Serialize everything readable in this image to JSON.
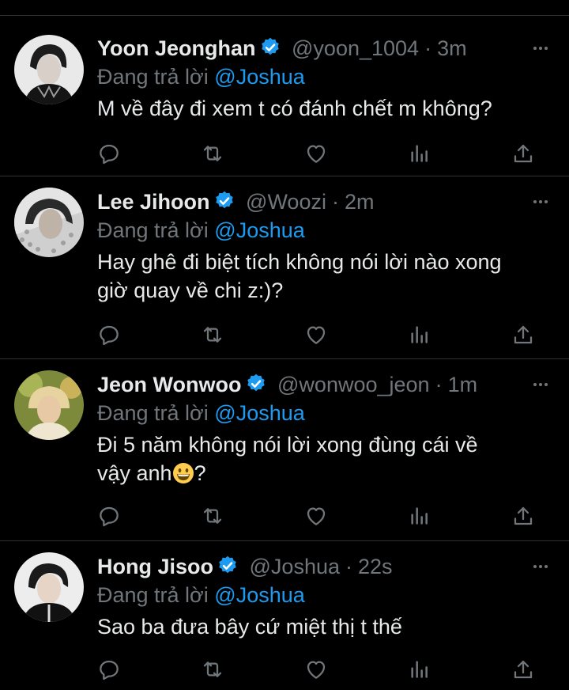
{
  "colors": {
    "background": "#000000",
    "text": "#e7e9ea",
    "secondary": "#71767b",
    "accent": "#1d9bf0",
    "divider": "#2f3336"
  },
  "tweets": [
    {
      "name": "Yoon Jeonghan",
      "handle": "@yoon_1004",
      "dot": "·",
      "time": "3m",
      "replying_prefix": "Đang trả lời",
      "replying_to": "@Joshua",
      "lines": [
        "M về đây đi xem t có đánh chết m không?"
      ],
      "avatar": "avatar-photo"
    },
    {
      "name": "Lee Jihoon",
      "handle": "@Woozi",
      "dot": "·",
      "time": "2m",
      "replying_prefix": "Đang trả lời",
      "replying_to": "@Joshua",
      "lines": [
        "Hay ghê đi biệt tích không nói lời nào xong",
        "giờ quay về chi z:)?"
      ],
      "avatar": "avatar-photo"
    },
    {
      "name": "Jeon Wonwoo",
      "handle": "@wonwoo_jeon",
      "dot": "·",
      "time": "1m",
      "replying_prefix": "Đang trả lời",
      "replying_to": "@Joshua",
      "lines": [
        "Đi 5 năm không nói lời xong đùng cái về",
        "vậy anh"
      ],
      "line_suffix": "?",
      "emoji": "grinning-face-emoji",
      "avatar": "avatar-photo"
    },
    {
      "name": "Hong Jisoo",
      "handle": "@Joshua",
      "dot": "·",
      "time": "22s",
      "replying_prefix": "Đang trả lời",
      "replying_to": "@Joshua",
      "lines": [
        "Sao ba đưa bây cứ miệt thị t thế"
      ],
      "avatar": "avatar-photo"
    }
  ],
  "icons": {
    "verified": "verified-badge-icon",
    "more": "more-options-icon",
    "reply": "reply-icon",
    "retweet": "retweet-icon",
    "like": "like-icon",
    "views": "views-icon",
    "share": "share-icon"
  }
}
